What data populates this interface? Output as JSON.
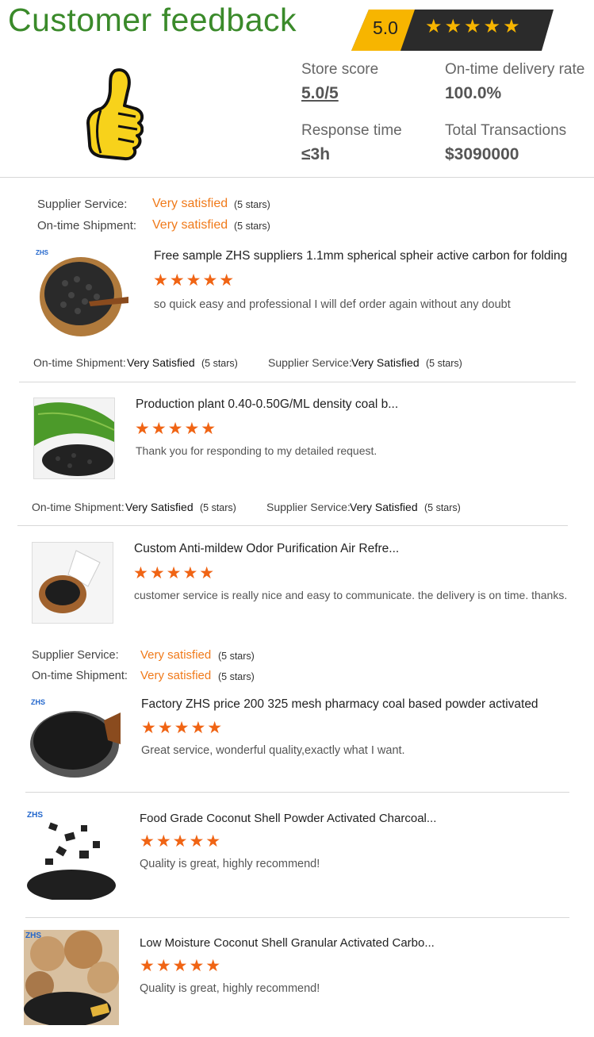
{
  "header": {
    "title": "Customer feedback",
    "badge_score": "5.0",
    "badge_stars": "★★★★★"
  },
  "stats": {
    "store_score_label": "Store score",
    "store_score_value": "5.0/5",
    "ontime_label": "On-time delivery rate",
    "ontime_value": "100.0%",
    "response_label": "Response time",
    "response_value": "≤3h",
    "transactions_label": "Total Transactions",
    "transactions_value": "$3090000"
  },
  "labels": {
    "supplier_service": "Supplier Service:",
    "ontime_shipment": "On-time Shipment:",
    "very_satisfied_lower": "Very satisfied",
    "very_satisfied_title": "Very Satisfied",
    "five_stars": "(5 stars)",
    "stars": "★★★★★",
    "zhs": "ZHS"
  },
  "reviews": [
    {
      "title": "Free sample ZHS suppliers 1.1mm spherical spheir active carbon for folding",
      "comment": "so quick easy and professional   I will def order again without any doubt"
    },
    {
      "title": "Production plant 0.40-0.50G/ML density coal b...",
      "comment": "Thank you for responding to my detailed request."
    },
    {
      "title": "Custom Anti-mildew Odor Purification Air Refre...",
      "comment": "customer service is really nice and easy to communicate. the delivery is on time. thanks."
    },
    {
      "title": "Factory ZHS price 200 325 mesh pharmacy coal based powder activated",
      "comment": "Great service, wonderful quality,exactly what I want."
    },
    {
      "title": "Food Grade Coconut Shell Powder Activated Charcoal...",
      "comment": "Quality is great, highly recommend!"
    },
    {
      "title": "Low Moisture Coconut Shell Granular Activated Carbo...",
      "comment": "Quality is great, highly recommend!"
    }
  ],
  "colors": {
    "title_green": "#3a8a2a",
    "badge_yellow": "#f7b500",
    "badge_dark": "#2b2b2b",
    "orange": "#f07a1a",
    "star_orange": "#f06414"
  }
}
